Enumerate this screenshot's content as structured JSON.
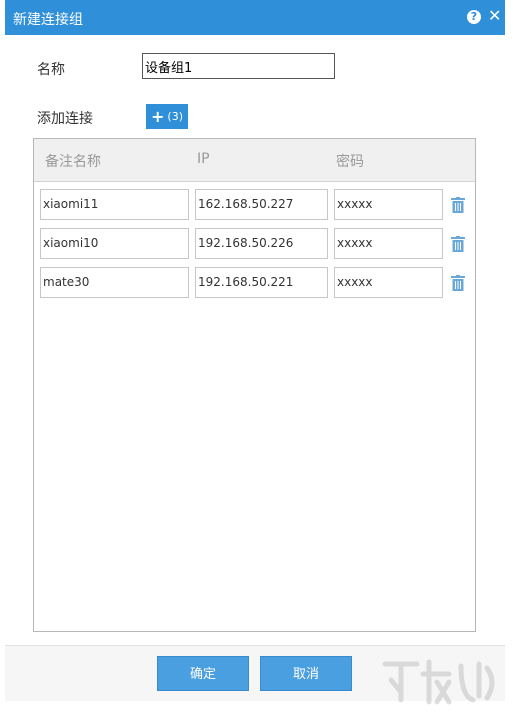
{
  "window": {
    "title": "新建连接组"
  },
  "form": {
    "name_label": "名称",
    "name_value": "设备组1",
    "add_label": "添加连接",
    "add_count": "(3)"
  },
  "table": {
    "headers": [
      "备注名称",
      "IP",
      "密码"
    ],
    "rows": [
      {
        "name": "xiaomi11",
        "ip": "162.168.50.227",
        "password": "xxxxx"
      },
      {
        "name": "xiaomi10",
        "ip": "192.168.50.226",
        "password": "xxxxx"
      },
      {
        "name": "mate30",
        "ip": "192.168.50.221",
        "password": "xxxxx"
      }
    ]
  },
  "footer": {
    "confirm_label": "确定",
    "cancel_label": "取消"
  },
  "colors": {
    "accent": "#2f8fd8",
    "button": "#4a9fe0",
    "icon": "#6aa8d8"
  }
}
